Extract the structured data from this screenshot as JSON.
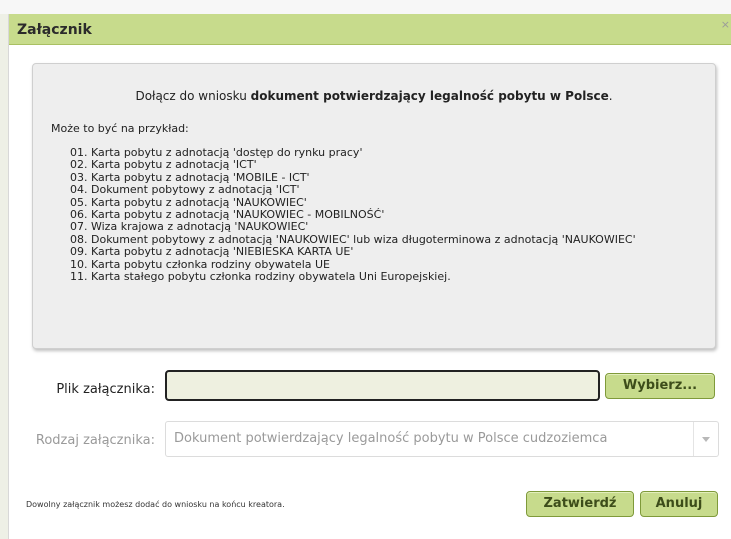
{
  "dialog": {
    "title": "Załącznik",
    "close_glyph": "×"
  },
  "info": {
    "intro_prefix": "Dołącz do wniosku ",
    "intro_bold": "dokument potwierdzający legalność pobytu w Polsce",
    "intro_suffix": ".",
    "examples_label": "Może to być na przykład:",
    "items": [
      "01. Karta pobytu z adnotacją 'dostęp do rynku pracy'",
      "02. Karta pobytu z adnotacją 'ICT'",
      "03. Karta pobytu z adnotacją 'MOBILE - ICT'",
      "04. Dokument pobytowy z adnotacją 'ICT'",
      "05. Karta pobytu z adnotacją 'NAUKOWIEC'",
      "06. Karta pobytu z adnotacją 'NAUKOWIEC - MOBILNOŚĆ'",
      "07. Wiza krajowa z adnotacją 'NAUKOWIEC'",
      "08. Dokument pobytowy z adnotacją 'NAUKOWIEC' lub wiza długoterminowa z adnotacją 'NAUKOWIEC'",
      "09. Karta pobytu z adnotacją 'NIEBIESKA KARTA UE'",
      "10. Karta pobytu członka rodziny obywatela UE",
      "11. Karta stałego pobytu członka rodziny obywatela Uni Europejskiej."
    ]
  },
  "form": {
    "file_label": "Plik załącznika:",
    "file_value": "",
    "choose_button": "Wybierz...",
    "type_label": "Rodzaj załącznika:",
    "type_value": "Dokument potwierdzający legalność pobytu w Polsce cudzoziemca"
  },
  "footer": {
    "note": "Dowolny załącznik możesz dodać do wniosku na końcu kreatora.",
    "confirm_button": "Zatwierdź",
    "cancel_button": "Anuluj"
  },
  "colors": {
    "accent": "#c7db8c",
    "accent_border": "#7f9a3a",
    "panel_bg": "#eeeeee"
  }
}
